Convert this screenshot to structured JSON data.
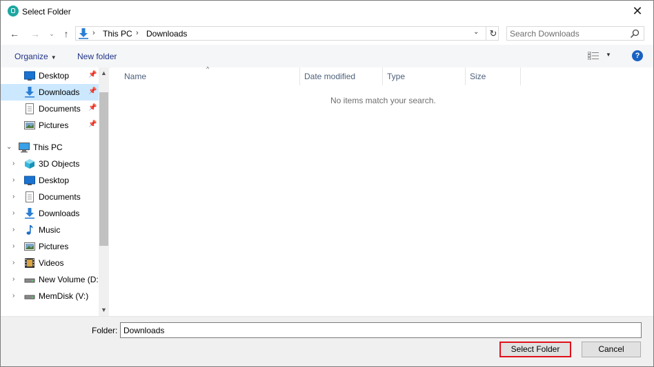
{
  "window": {
    "title": "Select Folder"
  },
  "address_bar": {
    "crumbs": [
      "This PC",
      "Downloads"
    ]
  },
  "search": {
    "placeholder": "Search Downloads"
  },
  "toolbar": {
    "organize_label": "Organize",
    "new_folder_label": "New folder"
  },
  "nav_pane": {
    "quick_access": [
      {
        "label": "Desktop",
        "icon": "desktop-icon",
        "pinned": true
      },
      {
        "label": "Downloads",
        "icon": "download-arrow-icon",
        "pinned": true,
        "selected": true
      },
      {
        "label": "Documents",
        "icon": "document-icon",
        "pinned": true
      },
      {
        "label": "Pictures",
        "icon": "pictures-icon",
        "pinned": true
      }
    ],
    "this_pc": {
      "label": "This PC",
      "icon": "computer-icon"
    },
    "this_pc_children": [
      {
        "label": "3D Objects",
        "icon": "cube-icon"
      },
      {
        "label": "Desktop",
        "icon": "desktop-icon"
      },
      {
        "label": "Documents",
        "icon": "document-icon"
      },
      {
        "label": "Downloads",
        "icon": "download-arrow-icon"
      },
      {
        "label": "Music",
        "icon": "music-note-icon"
      },
      {
        "label": "Pictures",
        "icon": "pictures-icon"
      },
      {
        "label": "Videos",
        "icon": "film-icon"
      },
      {
        "label": "New Volume (D:)",
        "icon": "drive-icon"
      },
      {
        "label": "MemDisk (V:)",
        "icon": "drive-icon"
      }
    ]
  },
  "file_list": {
    "columns": [
      "Name",
      "Date modified",
      "Type",
      "Size"
    ],
    "empty_message": "No items match your search."
  },
  "footer": {
    "folder_label": "Folder:",
    "folder_value": "Downloads",
    "select_button": "Select Folder",
    "cancel_button": "Cancel"
  },
  "colors": {
    "accent": "#0078d7",
    "selection": "#cce8ff",
    "highlight_border": "#e0101a",
    "link": "#1e3287"
  }
}
